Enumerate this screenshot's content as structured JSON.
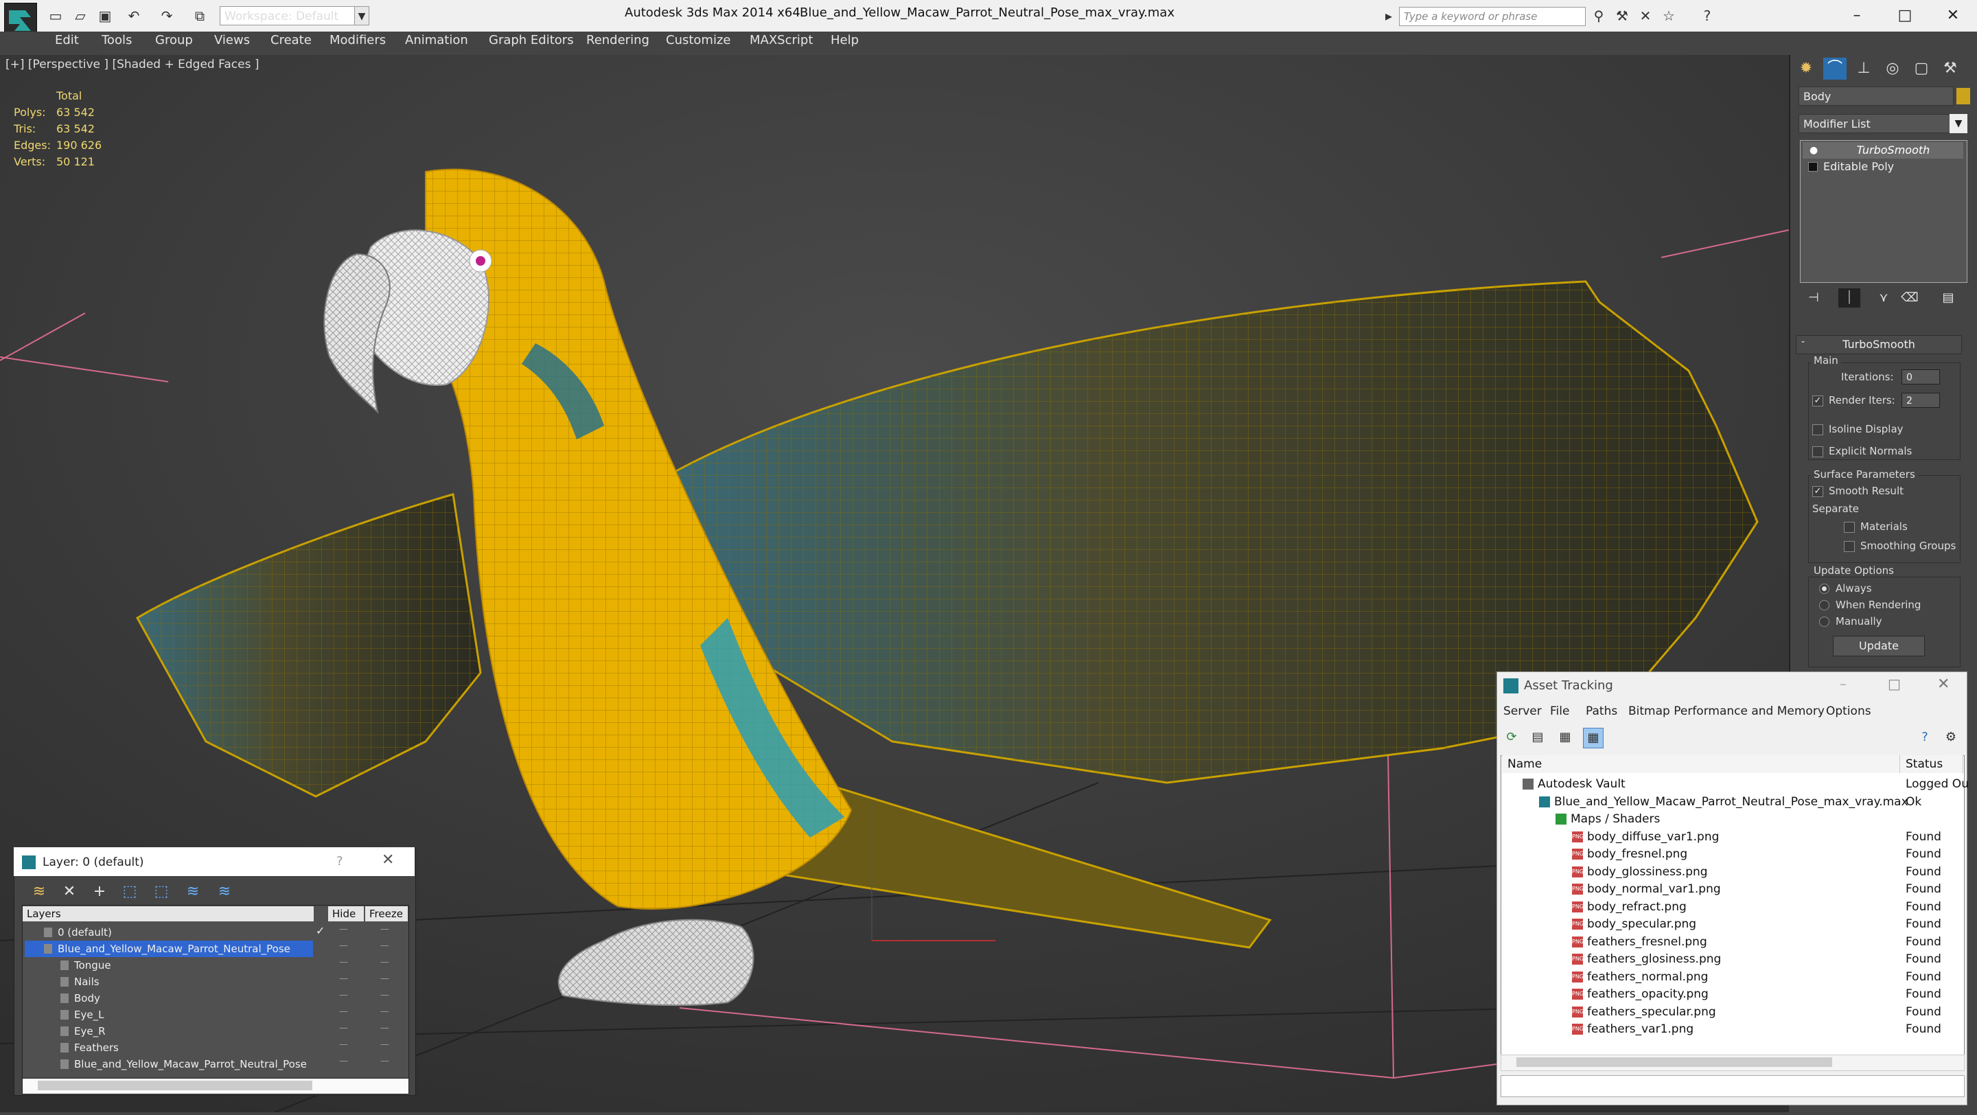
{
  "window": {
    "app_title": "Autodesk 3ds Max  2014 x64",
    "file_title": "Blue_and_Yellow_Macaw_Parrot_Neutral_Pose_max_vray.max",
    "workspace": "Workspace: Default",
    "search_placeholder": "Type a keyword or phrase"
  },
  "menu": [
    "Edit",
    "Tools",
    "Group",
    "Views",
    "Create",
    "Modifiers",
    "Animation",
    "Graph Editors",
    "Rendering",
    "Customize",
    "MAXScript",
    "Help"
  ],
  "viewport": {
    "label": "[+] [Perspective ] [Shaded + Edged Faces ]",
    "stats": {
      "header": "Total",
      "rows": [
        {
          "label": "Polys:",
          "value": "63 542"
        },
        {
          "label": "Tris:",
          "value": "63 542"
        },
        {
          "label": "Edges:",
          "value": "190 626"
        },
        {
          "label": "Verts:",
          "value": "50 121"
        }
      ]
    }
  },
  "command_panel": {
    "object_name": "Body",
    "object_color": "#cca41c",
    "modifier_list": "Modifier List",
    "stack": [
      "TurboSmooth",
      "Editable Poly"
    ],
    "rollout_title": "TurboSmooth",
    "main_group": "Main",
    "iterations_label": "Iterations:",
    "iterations_value": "0",
    "render_iters_label": "Render Iters:",
    "render_iters_value": "2",
    "isoline": "Isoline Display",
    "explicit_normals": "Explicit Normals",
    "surface_group": "Surface Parameters",
    "smooth_result": "Smooth Result",
    "separate": "Separate",
    "materials": "Materials",
    "smoothing_groups": "Smoothing Groups",
    "update_group": "Update Options",
    "always": "Always",
    "when_rendering": "When Rendering",
    "manually": "Manually",
    "update_button": "Update"
  },
  "layer_dialog": {
    "title": "Layer: 0 (default)",
    "help": "?",
    "col_layers": "Layers",
    "col_hide": "Hide",
    "col_freeze": "Freeze",
    "rows": [
      {
        "name": "0 (default)",
        "indent": 1
      },
      {
        "name": "Blue_and_Yellow_Macaw_Parrot_Neutral_Pose",
        "indent": 1
      },
      {
        "name": "Tongue",
        "indent": 2
      },
      {
        "name": "Nails",
        "indent": 2
      },
      {
        "name": "Body",
        "indent": 2
      },
      {
        "name": "Eye_L",
        "indent": 2
      },
      {
        "name": "Eye_R",
        "indent": 2
      },
      {
        "name": "Feathers",
        "indent": 2
      },
      {
        "name": "Blue_and_Yellow_Macaw_Parrot_Neutral_Pose",
        "indent": 2
      }
    ]
  },
  "asset_tracking": {
    "title": "Asset Tracking",
    "menu": [
      "Server",
      "File",
      "Paths",
      "Bitmap Performance and Memory",
      "Options"
    ],
    "col_name": "Name",
    "col_status": "Status",
    "rows": [
      {
        "name": "Autodesk Vault",
        "status": "Logged Ou",
        "level": 0,
        "icon": "vault"
      },
      {
        "name": "Blue_and_Yellow_Macaw_Parrot_Neutral_Pose_max_vray.max",
        "status": "Ok",
        "level": 1,
        "icon": "max"
      },
      {
        "name": "Maps / Shaders",
        "status": "",
        "level": 2,
        "icon": "folder"
      },
      {
        "name": "body_diffuse_var1.png",
        "status": "Found",
        "level": 3,
        "icon": "png"
      },
      {
        "name": "body_fresnel.png",
        "status": "Found",
        "level": 3,
        "icon": "png"
      },
      {
        "name": "body_glossiness.png",
        "status": "Found",
        "level": 3,
        "icon": "png"
      },
      {
        "name": "body_normal_var1.png",
        "status": "Found",
        "level": 3,
        "icon": "png"
      },
      {
        "name": "body_refract.png",
        "status": "Found",
        "level": 3,
        "icon": "png"
      },
      {
        "name": "body_specular.png",
        "status": "Found",
        "level": 3,
        "icon": "png"
      },
      {
        "name": "feathers_fresnel.png",
        "status": "Found",
        "level": 3,
        "icon": "png"
      },
      {
        "name": "feathers_glosiness.png",
        "status": "Found",
        "level": 3,
        "icon": "png"
      },
      {
        "name": "feathers_normal.png",
        "status": "Found",
        "level": 3,
        "icon": "png"
      },
      {
        "name": "feathers_opacity.png",
        "status": "Found",
        "level": 3,
        "icon": "png"
      },
      {
        "name": "feathers_specular.png",
        "status": "Found",
        "level": 3,
        "icon": "png"
      },
      {
        "name": "feathers_var1.png",
        "status": "Found",
        "level": 3,
        "icon": "png"
      }
    ]
  }
}
